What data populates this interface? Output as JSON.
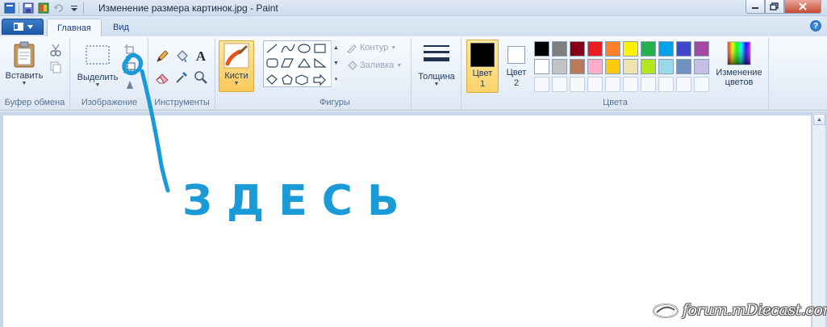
{
  "window": {
    "title": "Изменение размера картинок.jpg - Paint"
  },
  "tabs": [
    {
      "label": "Главная",
      "active": true
    },
    {
      "label": "Вид",
      "active": false
    }
  ],
  "ribbon": {
    "clipboard": {
      "label": "Буфер обмена",
      "paste_label": "Вставить"
    },
    "image": {
      "label": "Изображение",
      "select_label": "Выделить"
    },
    "tools": {
      "label": "Инструменты"
    },
    "brushes": {
      "label": "Кисти"
    },
    "shapes": {
      "label": "Фигуры",
      "outline_label": "Контур",
      "fill_label": "Заливка"
    },
    "size": {
      "label": "Толщина"
    },
    "colors": {
      "label": "Цвета",
      "color1_line1": "Цвет",
      "color1_line2": "1",
      "color2_line1": "Цвет",
      "color2_line2": "2",
      "color1_value": "#000000",
      "color2_value": "#ffffff",
      "edit_line1": "Изменение",
      "edit_line2": "цветов",
      "palette_row1": [
        "#000000",
        "#7f7f7f",
        "#880015",
        "#ed1c24",
        "#ff7f27",
        "#fff200",
        "#22b14c",
        "#00a2e8",
        "#3f48cc",
        "#a349a4"
      ],
      "palette_row2": [
        "#ffffff",
        "#c3c3c3",
        "#b97a57",
        "#ffaec9",
        "#ffc90e",
        "#efe4b0",
        "#b5e61d",
        "#99d9ea",
        "#7092be",
        "#c8bfe7"
      ]
    }
  },
  "annotation": {
    "text": "ЗДЕСЬ",
    "stroke_color": "#1a9ad6"
  },
  "watermark": {
    "text": "forum.mDiecast.com"
  }
}
